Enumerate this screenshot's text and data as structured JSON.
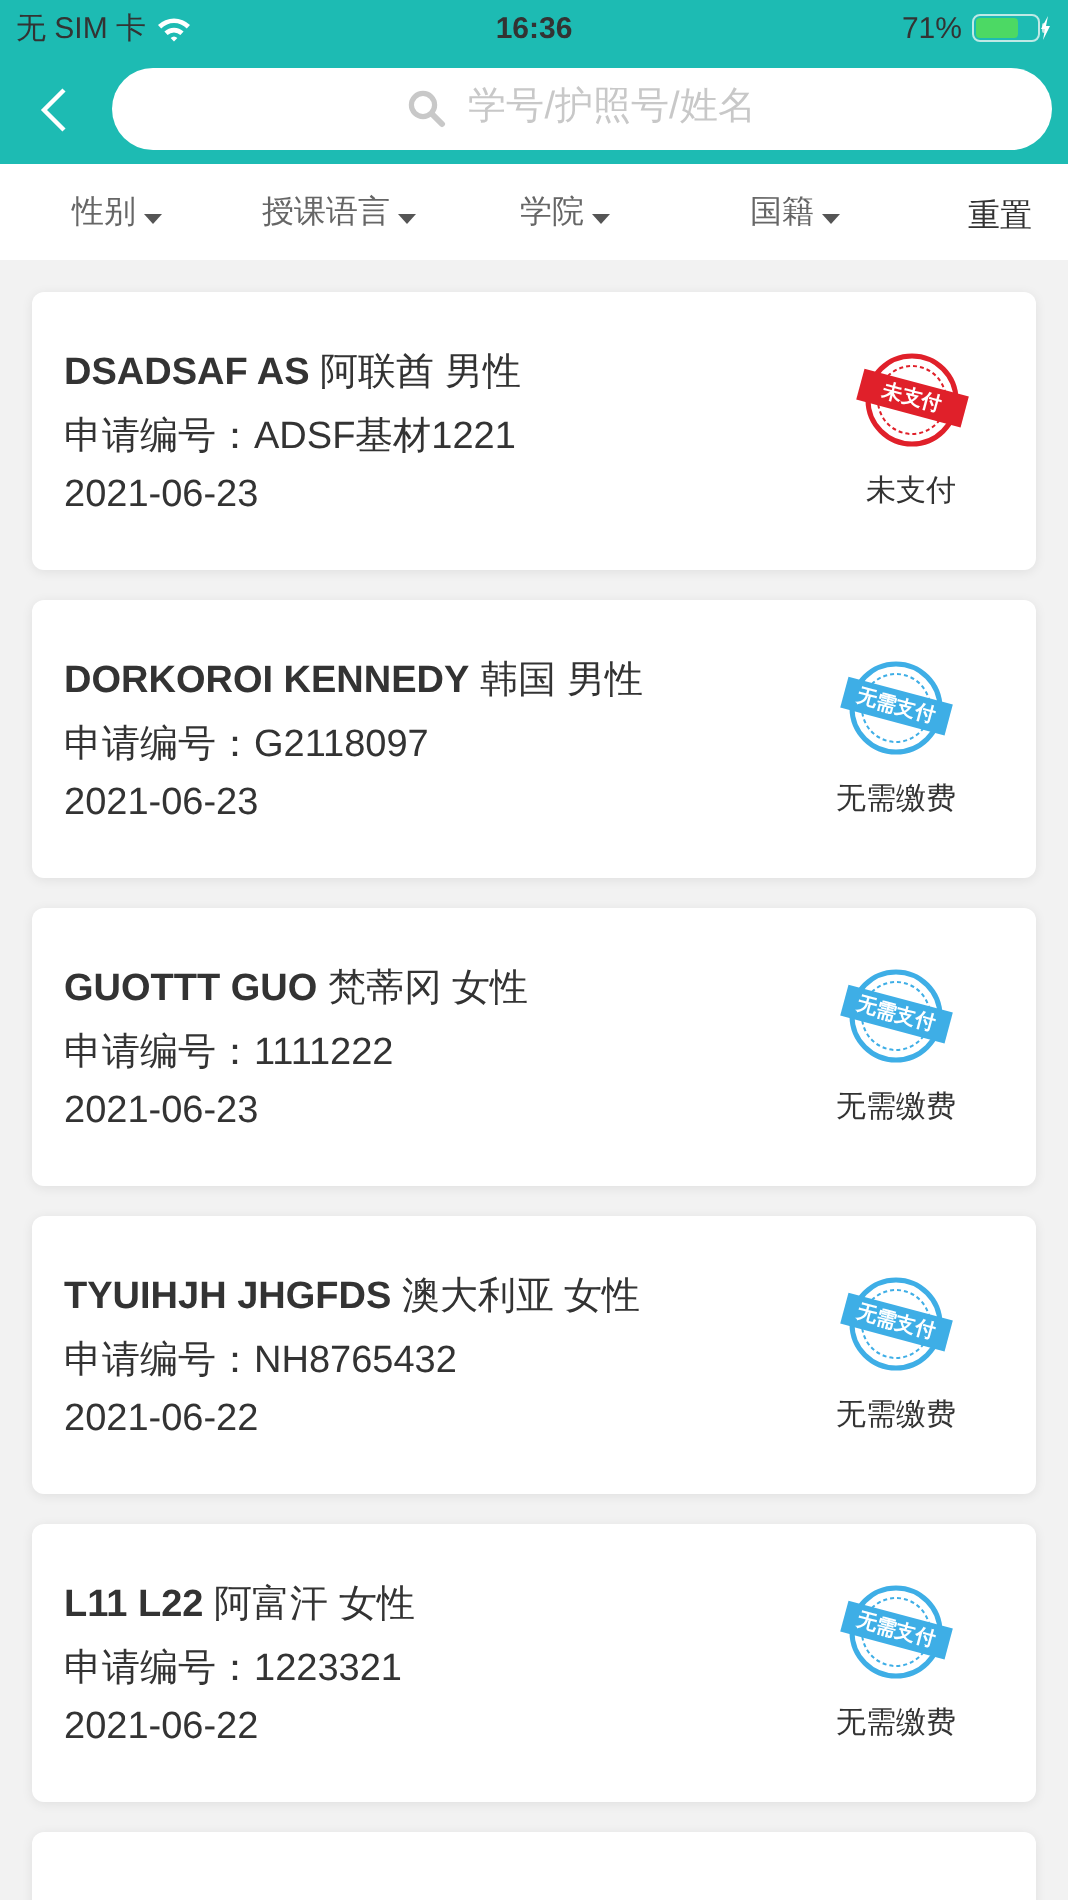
{
  "status_bar": {
    "carrier": "无 SIM 卡",
    "time": "16:36",
    "battery": "71%"
  },
  "search": {
    "placeholder": "学号/护照号/姓名"
  },
  "filters": [
    {
      "label": "性别"
    },
    {
      "label": "授课语言"
    },
    {
      "label": "学院"
    },
    {
      "label": "国籍"
    }
  ],
  "reset": "重置",
  "records": [
    {
      "name": "DSADSAF AS",
      "country": "阿联酋",
      "gender": "男性",
      "application": "申请编号：ADSF基材1221",
      "date": "2021-06-23",
      "kind": "unpaid",
      "stamp": "未支付",
      "status": "未支付"
    },
    {
      "name": "DORKOROI KENNEDY",
      "country": "韩国",
      "gender": "男性",
      "application": "申请编号：G2118097",
      "date": "2021-06-23",
      "kind": "exempt",
      "stamp": "无需支付",
      "status": "无需缴费"
    },
    {
      "name": "GUOTTT GUO",
      "country": "梵蒂冈",
      "gender": "女性",
      "application": "申请编号：1111222",
      "date": "2021-06-23",
      "kind": "exempt",
      "stamp": "无需支付",
      "status": "无需缴费"
    },
    {
      "name": "TYUIHJH JHGFDS",
      "country": "澳大利亚",
      "gender": "女性",
      "application": "申请编号：NH8765432",
      "date": "2021-06-22",
      "kind": "exempt",
      "stamp": "无需支付",
      "status": "无需缴费"
    },
    {
      "name": "L11 L22",
      "country": "阿富汗",
      "gender": "女性",
      "application": "申请编号：1223321",
      "date": "2021-06-22",
      "kind": "exempt",
      "stamp": "无需支付",
      "status": "无需缴费"
    }
  ]
}
